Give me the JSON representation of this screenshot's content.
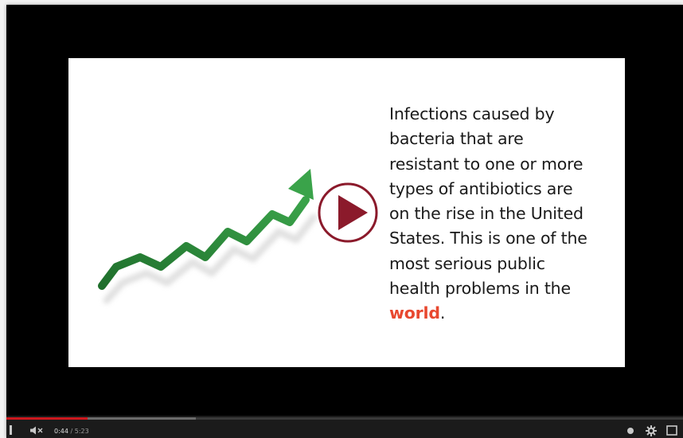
{
  "slide": {
    "lines": [
      "Infections caused by",
      "bacteria that are",
      "resistant to one or more",
      "types of antibiotics are",
      "on the rise in the United",
      "States.  This is one of the",
      "most serious public",
      "health problems in the"
    ],
    "highlight_word": "world",
    "trailing_text": "."
  },
  "player": {
    "current_time": "0:44",
    "separator": " / ",
    "duration": "5:23",
    "progress_played_fraction": 0.12,
    "progress_buffered_fraction": 0.28
  },
  "colors": {
    "player_background": "#000000",
    "play_button": "#8b1a2b",
    "highlight": "#e8482f",
    "arrow": "#2e8b3a",
    "progress": "#cc181e"
  },
  "icons": {
    "play": "play-icon",
    "volume": "volume-muted-icon",
    "settings": "gear-icon",
    "fullscreen": "fullscreen-icon",
    "annotations": "dot-icon",
    "pause": "pause-icon"
  }
}
